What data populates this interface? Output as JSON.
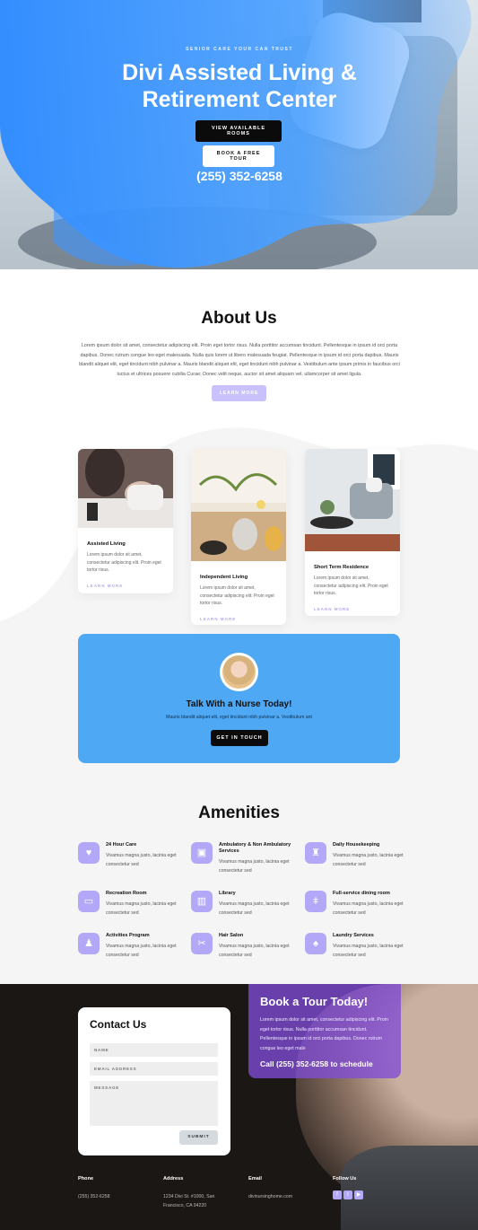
{
  "hero": {
    "kicker": "SENIOR CARE YOUR CAN TRUST",
    "title": "Divi Assisted Living & Retirement Center",
    "btn_rooms": "VIEW AVAILABLE ROOMS",
    "btn_tour": "BOOK A FREE TOUR",
    "phone": "(255) 352-6258"
  },
  "about": {
    "title": "About Us",
    "text": "Lorem ipsum dolor sit amet, consectetur adipiscing elit. Proin eget tortor risus. Nulla porttitor accumsan tincidunt. Pellentesque in ipsum id orci porta dapibus. Donec rutrum congue leo eget malesuada. Nulla quis lorem ut libero malesuada feugiat. Pellentesque in ipsum id orci porta dapibus. Mauris blandit aliquet elit, eget tincidunt nibh pulvinar a. Mauris blandit aliquet elit, eget tincidunt nibh pulvinar a. Vestibulum ante ipsum primis in faucibus orci luctus et ultrices posuere cubilia Curae; Donec velit neque, auctor sit amet aliquam vel, ullamcorper sit amet ligula.",
    "button": "LEARN MORE"
  },
  "services": [
    {
      "title": "Assisted Living",
      "text": "Lorem ipsum dolor sit amet, consectetur adipiscing elit. Proin eget tortor risus.",
      "link": "LEARN MORE"
    },
    {
      "title": "Independent Living",
      "text": "Lorem ipsum dolor sit amet, consectetur adipiscing elit. Proin eget tortor risus.",
      "link": "LEARN MORE"
    },
    {
      "title": "Short Term Residence",
      "text": "Lorem ipsum dolor sit amet, consectetur adipiscing elit. Proin eget tortor risus.",
      "link": "LEARN MORE"
    }
  ],
  "nurse": {
    "title": "Talk With a Nurse Today!",
    "text": "Mauris blandit aliquet elit, eget tincidunt nibh pulvinar a. Vestibulum ant",
    "button": "GET IN TOUCH"
  },
  "amenities": {
    "title": "Amenities",
    "items": [
      {
        "icon": "hand-heart-icon",
        "name": "24 Hour Care",
        "desc": "Vivamus magna justo, lacinia eget consectetur sed"
      },
      {
        "icon": "medical-kit-icon",
        "name": "Ambulatory & Non Ambulatory Services",
        "desc": "Vivamus magna justo, lacinia eget consectetur sed"
      },
      {
        "icon": "spray-bottle-icon",
        "name": "Daily Housekeeping",
        "desc": "Vivamus magna justo, lacinia eget consectetur sed"
      },
      {
        "icon": "tv-icon",
        "name": "Recreation Room",
        "desc": "Vivamus magna justo, lacinia eget consectetur sed"
      },
      {
        "icon": "book-icon",
        "name": "Library",
        "desc": "Vivamus magna justo, lacinia eget consectetur sed"
      },
      {
        "icon": "dining-icon",
        "name": "Full-service dining room",
        "desc": "Vivamus magna justo, lacinia eget consectetur sed"
      },
      {
        "icon": "activities-icon",
        "name": "Activities Program",
        "desc": "Vivamus magna justo, lacinia eget consectetur sed"
      },
      {
        "icon": "scissors-icon",
        "name": "Hair Salon",
        "desc": "Vivamus magna justo, lacinia eget consectetur sed"
      },
      {
        "icon": "shirt-icon",
        "name": "Laundry Services",
        "desc": "Vivamus magna justo, lacinia eget consectetur sed"
      }
    ]
  },
  "tour": {
    "title": "Book a Tour Today!",
    "text": "Lorem ipsum dolor sit amet, consectetur adipiscing elit. Proin eget tortor risus. Nulla porttitor accumsan tincidunt. Pellentesque in ipsum id orci porta dapibus. Donec rutrum congue leo eget male",
    "call": "Call (255) 352-6258 to schedule"
  },
  "contact": {
    "title": "Contact Us",
    "name_placeholder": "NAME",
    "email_placeholder": "EMAIL ADDRESS",
    "message_placeholder": "MESSAGE",
    "submit": "SUBMIT"
  },
  "footer": {
    "phone_label": "Phone",
    "phone": "(255) 352-6258",
    "address_label": "Address",
    "address": "1234 Divi St. #1000, San Francisco, CA 94220",
    "email_label": "Email",
    "email": "divinursinghome.com",
    "follow_label": "Follow Us",
    "social": [
      {
        "icon": "facebook-icon",
        "glyph": "f"
      },
      {
        "icon": "twitter-icon",
        "glyph": "t"
      },
      {
        "icon": "youtube-icon",
        "glyph": "▶"
      }
    ]
  }
}
